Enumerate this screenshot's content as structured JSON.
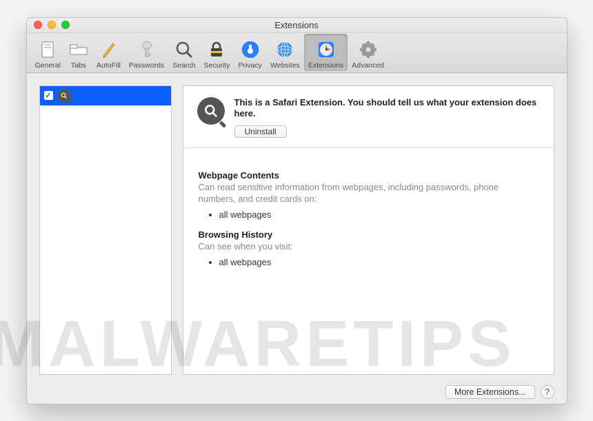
{
  "window": {
    "title": "Extensions"
  },
  "toolbar": {
    "items": [
      {
        "label": "General"
      },
      {
        "label": "Tabs"
      },
      {
        "label": "AutoFill"
      },
      {
        "label": "Passwords"
      },
      {
        "label": "Search"
      },
      {
        "label": "Security"
      },
      {
        "label": "Privacy"
      },
      {
        "label": "Websites"
      },
      {
        "label": "Extensions"
      },
      {
        "label": "Advanced"
      }
    ]
  },
  "extension": {
    "description": "This is a Safari Extension. You should tell us what your extension does here.",
    "uninstall_label": "Uninstall",
    "sections": {
      "contents_title": "Webpage Contents",
      "contents_sub": "Can read sensitive information from webpages, including passwords, phone numbers, and credit cards on:",
      "contents_item": "all webpages",
      "history_title": "Browsing History",
      "history_sub": "Can see when you visit:",
      "history_item": "all webpages"
    }
  },
  "footer": {
    "more_label": "More Extensions...",
    "help_label": "?"
  },
  "watermark": "MALWARETIPS"
}
